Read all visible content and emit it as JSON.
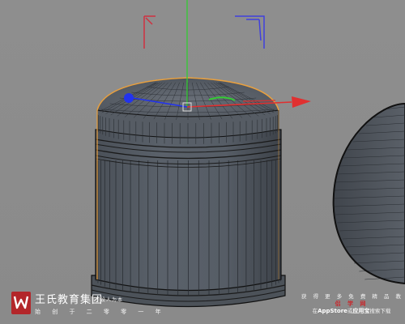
{
  "viewport": {
    "background": "#8c8c8c"
  },
  "axis_colors": {
    "x": "#e03030",
    "y": "#33cc33",
    "z": "#2233ee",
    "selection": "#e8a040"
  },
  "icons": [
    "wangshi-logo-icon",
    "move-gizmo-icon",
    "camera-corner-bracket-icon"
  ],
  "watermark": {
    "title": "王氏教育集团",
    "tag": "设人为本",
    "motto": "始 创 于 二 零 零 一 年"
  },
  "promo": {
    "line1": "获 得 更 多 免 费 精 品 教 程",
    "brand": "侣 学 网",
    "line3_prefix": "在",
    "appstore": "AppStore",
    "line3_mid": "或",
    "app": "应用宝",
    "line3_suffix": "搜索下载"
  }
}
